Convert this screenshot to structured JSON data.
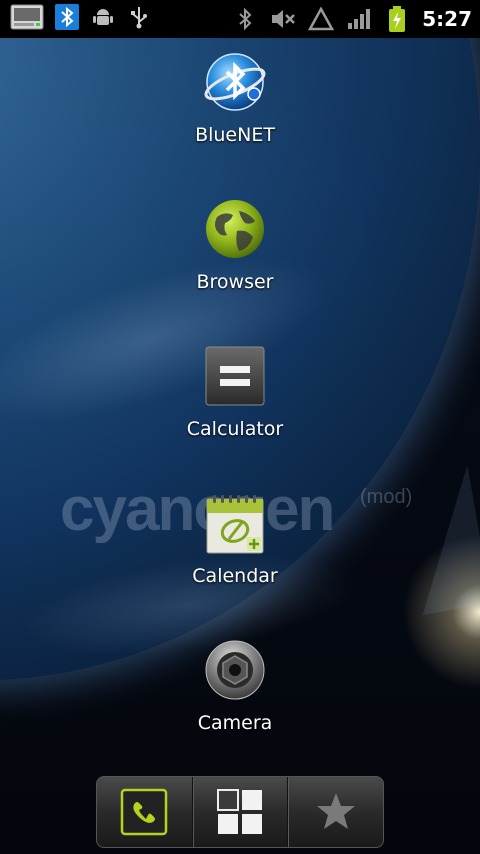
{
  "status_bar": {
    "time": "5:27",
    "notification_icons": [
      "usb-storage-icon",
      "bluetooth-notification-icon",
      "android-debug-icon",
      "usb-icon"
    ],
    "system_icons": [
      "bluetooth-icon",
      "mute-icon",
      "signal-triangle-icon",
      "signal-bars-icon",
      "battery-charging-icon"
    ]
  },
  "wallpaper": {
    "brand": "cyanogen",
    "brand_suffix": "(mod)"
  },
  "apps": [
    {
      "label": "BlueNET",
      "icon": "bluenet-icon"
    },
    {
      "label": "Browser",
      "icon": "globe-icon"
    },
    {
      "label": "Calculator",
      "icon": "calculator-icon"
    },
    {
      "label": "Calendar",
      "icon": "calendar-icon"
    },
    {
      "label": "Camera",
      "icon": "camera-icon"
    }
  ],
  "dock": {
    "items": [
      "phone-icon",
      "all-apps-grid-icon",
      "favorites-star-icon"
    ]
  },
  "colors": {
    "phone_accent": "#b6d21e",
    "battery": "#a8d01c"
  }
}
